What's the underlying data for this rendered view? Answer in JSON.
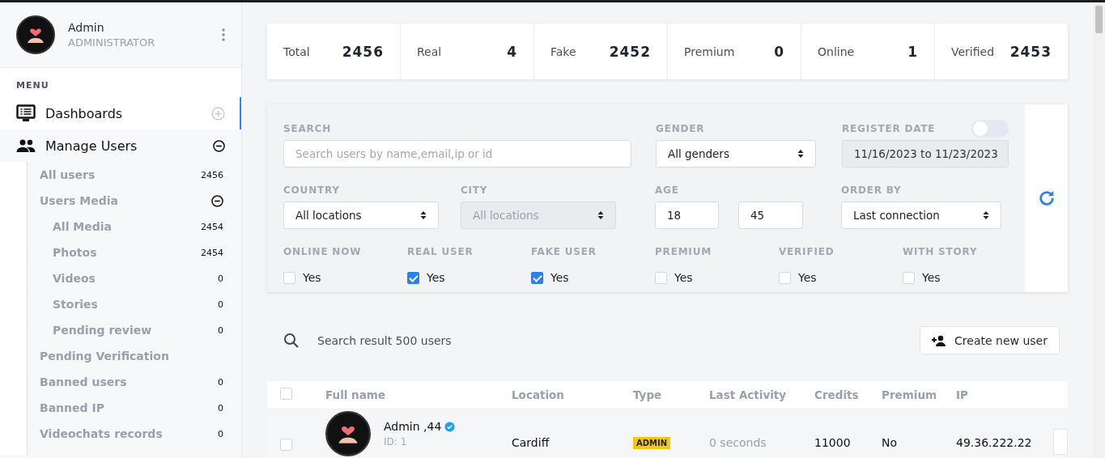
{
  "user": {
    "name": "Admin",
    "role": "ADMINISTRATOR"
  },
  "menu": {
    "heading": "MENU",
    "items": [
      {
        "label": "Dashboards",
        "selected": true,
        "expanded": false
      },
      {
        "label": "Manage Users",
        "selected": false,
        "expanded": true,
        "children": [
          {
            "label": "All users",
            "count": "2456"
          },
          {
            "label": "Users Media",
            "expanded": true,
            "children": [
              {
                "label": "All Media",
                "count": "2454"
              },
              {
                "label": "Photos",
                "count": "2454"
              },
              {
                "label": "Videos",
                "count": "0"
              },
              {
                "label": "Stories",
                "count": "0"
              },
              {
                "label": "Pending review",
                "count": "0"
              }
            ]
          },
          {
            "label": "Pending Verification"
          },
          {
            "label": "Banned users",
            "count": "0"
          },
          {
            "label": "Banned IP",
            "count": "0"
          },
          {
            "label": "Videochats records",
            "count": "0"
          }
        ]
      }
    ]
  },
  "stats": [
    {
      "label": "Total",
      "value": "2456"
    },
    {
      "label": "Real",
      "value": "4"
    },
    {
      "label": "Fake",
      "value": "2452"
    },
    {
      "label": "Premium",
      "value": "0"
    },
    {
      "label": "Online",
      "value": "1"
    },
    {
      "label": "Verified",
      "value": "2453"
    }
  ],
  "filters": {
    "search": {
      "label": "SEARCH",
      "placeholder": "Search users by name,email,ip or id"
    },
    "gender": {
      "label": "GENDER",
      "value": "All genders"
    },
    "register_date": {
      "label": "REGISTER DATE",
      "on": false,
      "value": "11/16/2023 to 11/23/2023",
      "disabled": true
    },
    "country": {
      "label": "COUNTRY",
      "value": "All locations",
      "disabled": false
    },
    "city": {
      "label": "CITY",
      "value": "All locations",
      "disabled": true
    },
    "age": {
      "label": "AGE",
      "min": "18",
      "max": "45"
    },
    "order_by": {
      "label": "ORDER BY",
      "value": "Last connection"
    },
    "checks": [
      {
        "label": "ONLINE NOW",
        "option": "Yes",
        "checked": false
      },
      {
        "label": "REAL USER",
        "option": "Yes",
        "checked": true
      },
      {
        "label": "FAKE USER",
        "option": "Yes",
        "checked": true
      },
      {
        "label": "PREMIUM",
        "option": "Yes",
        "checked": false
      },
      {
        "label": "VERIFIED",
        "option": "Yes",
        "checked": false
      },
      {
        "label": "WITH STORY",
        "option": "Yes",
        "checked": false
      }
    ]
  },
  "results": {
    "summary": "Search result 500 users",
    "create_button": "Create new user"
  },
  "table": {
    "all_selected": false,
    "columns": [
      "Full name",
      "Location",
      "Type",
      "Last Activity",
      "Credits",
      "Premium",
      "IP"
    ],
    "rows": [
      {
        "name": "Admin ,44",
        "verified": true,
        "id": "ID: 1",
        "location": "Cardiff",
        "type": "ADMIN",
        "last_activity": "0 seconds",
        "credits": "11000",
        "premium": "No",
        "ip": "49.36.222.22",
        "selected": false
      }
    ]
  }
}
